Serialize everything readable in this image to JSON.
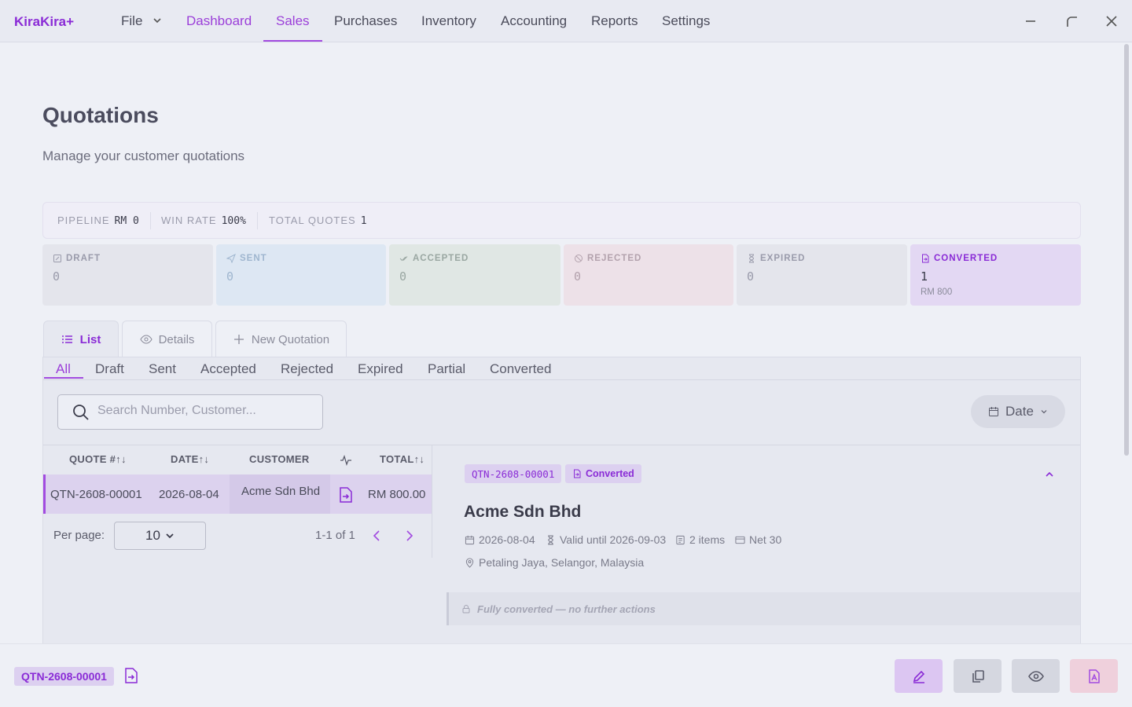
{
  "app": {
    "brand": "KiraKira+"
  },
  "menu": {
    "file": "File",
    "items": [
      "Dashboard",
      "Sales",
      "Purchases",
      "Inventory",
      "Accounting",
      "Reports",
      "Settings"
    ]
  },
  "page": {
    "title": "Quotations",
    "subtitle": "Manage your customer quotations"
  },
  "stats": {
    "pipeline_label": "PIPELINE",
    "pipeline_value": "RM 0",
    "winrate_label": "WIN RATE",
    "winrate_value": "100%",
    "total_label": "TOTAL QUOTES",
    "total_value": "1"
  },
  "cards": [
    {
      "label": "DRAFT",
      "value": "0",
      "icon": "draft-icon",
      "bg": "#e4e5ec",
      "fg": "#9a9bab"
    },
    {
      "label": "SENT",
      "value": "0",
      "icon": "send-icon",
      "bg": "#dde7f3",
      "fg": "#9fb6cf"
    },
    {
      "label": "ACCEPTED",
      "value": "0",
      "icon": "double-check-icon",
      "bg": "#e0e7e4",
      "fg": "#9aa7a2"
    },
    {
      "label": "REJECTED",
      "value": "0",
      "icon": "ban-icon",
      "bg": "#ede1e8",
      "fg": "#b3a2ad"
    },
    {
      "label": "EXPIRED",
      "value": "0",
      "icon": "hourglass-icon",
      "bg": "#e4e5ec",
      "fg": "#9a9bab"
    },
    {
      "label": "CONVERTED",
      "value": "1",
      "sub": "RM 800",
      "icon": "file-convert-icon",
      "bg": "#e3d8f3",
      "fg": "#8a2bd6"
    }
  ],
  "view_tabs": {
    "list": "List",
    "details": "Details",
    "new": "New Quotation"
  },
  "filters": [
    "All",
    "Draft",
    "Sent",
    "Accepted",
    "Rejected",
    "Expired",
    "Partial",
    "Converted"
  ],
  "search": {
    "placeholder": "Search Number, Customer..."
  },
  "date_button": "Date",
  "table": {
    "headers": {
      "quote": "QUOTE #",
      "date": "DATE",
      "customer": "CUSTOMER",
      "total": "TOTAL"
    },
    "rows": [
      {
        "quote": "QTN-2608-00001",
        "date": "2026-08-04",
        "customer": "Acme Sdn Bhd",
        "total": "RM 800.00"
      }
    ]
  },
  "pagination": {
    "per_page_label": "Per page:",
    "per_page": "10",
    "range": "1-1 of 1"
  },
  "detail": {
    "number": "QTN-2608-00001",
    "status": "Converted",
    "customer": "Acme Sdn Bhd",
    "date": "2026-08-04",
    "valid_until": "Valid until 2026-09-03",
    "items": "2 items",
    "terms": "Net 30",
    "location": "Petaling Jaya, Selangor, Malaysia",
    "notice": "Fully converted — no further actions"
  },
  "bottom": {
    "number": "QTN-2608-00001"
  },
  "colors": {
    "accent": "#8a2bd6",
    "background": "#eef0f6"
  }
}
